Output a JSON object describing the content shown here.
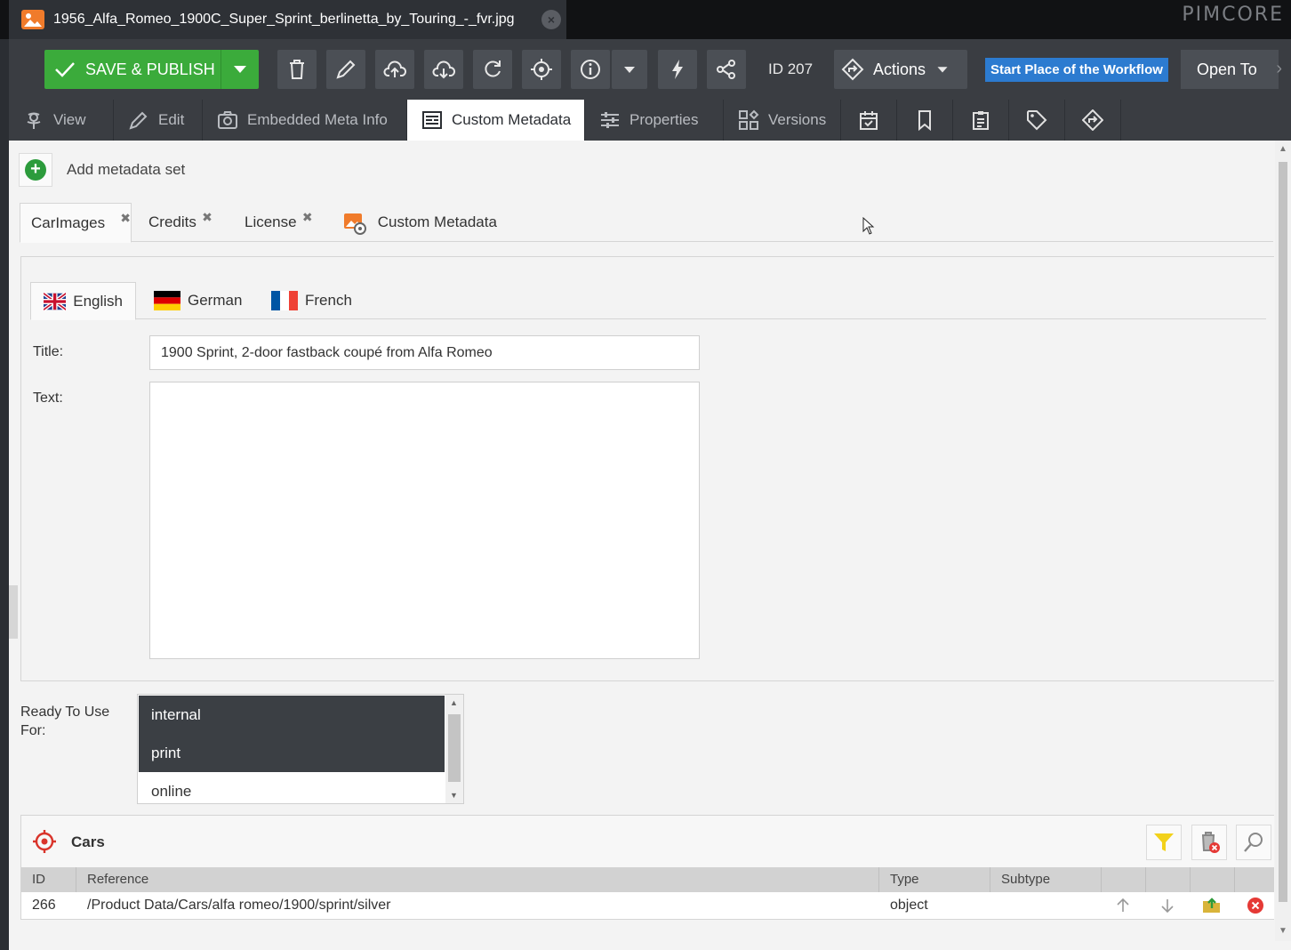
{
  "window": {
    "tab_title": "1956_Alfa_Romeo_1900C_Super_Sprint_berlinetta_by_Touring_-_fvr.jpg",
    "close_symbol": "×",
    "brand": "PIMCORE"
  },
  "toolbar": {
    "save_label": "SAVE & PUBLISH",
    "id_label": "ID 207",
    "actions_label": "Actions",
    "workflow_badge": "Start Place of the Workflow",
    "open_to_label": "Open To",
    "more_symbol": "›",
    "icons": [
      "checkmark-icon",
      "chevron-down-icon",
      "trash-icon",
      "pencil-icon",
      "upload-cloud-icon",
      "download-cloud-icon",
      "refresh-icon",
      "crosshair-icon",
      "info-icon",
      "chevron-down-icon",
      "lightning-icon",
      "share-icon",
      "workflow-icon"
    ]
  },
  "main_tabs": [
    {
      "label": "View",
      "icon": "flower-icon"
    },
    {
      "label": "Edit",
      "icon": "pencil-icon"
    },
    {
      "label": "Embedded Meta Info",
      "icon": "camera-icon"
    },
    {
      "label": "Custom Metadata",
      "icon": "metadata-icon",
      "active": true
    },
    {
      "label": "Properties",
      "icon": "sliders-icon"
    },
    {
      "label": "Versions",
      "icon": "versions-icon"
    },
    {
      "label": "",
      "icon": "calendar-icon"
    },
    {
      "label": "",
      "icon": "bookmark-icon"
    },
    {
      "label": "",
      "icon": "clipboard-icon"
    },
    {
      "label": "",
      "icon": "tag-icon"
    },
    {
      "label": "",
      "icon": "workflow-icon"
    }
  ],
  "metadata": {
    "add_set_label": "Add metadata set",
    "set_tabs": [
      {
        "label": "CarImages",
        "closable": true,
        "active": true
      },
      {
        "label": "Credits",
        "closable": true
      },
      {
        "label": "License",
        "closable": true
      },
      {
        "label": "Custom Metadata",
        "icon": "image-gear-icon"
      }
    ],
    "close_symbol": "✖",
    "languages": [
      {
        "label": "English",
        "flag": "uk-flag-icon",
        "active": true
      },
      {
        "label": "German",
        "flag": "germany-flag-icon"
      },
      {
        "label": "French",
        "flag": "france-flag-icon"
      }
    ],
    "title_label": "Title:",
    "title_value": "1900 Sprint, 2-door fastback coupé from Alfa Romeo",
    "text_label": "Text:",
    "text_value": "",
    "ready_label": "Ready To Use For:",
    "ready_options": [
      {
        "label": "internal",
        "selected": true
      },
      {
        "label": "print",
        "selected": true
      },
      {
        "label": "online",
        "selected": false
      }
    ]
  },
  "cars": {
    "title": "Cars",
    "columns": [
      "ID",
      "Reference",
      "Type",
      "Subtype"
    ],
    "rows": [
      {
        "id": "266",
        "reference": "/Product Data/Cars/alfa romeo/1900/sprint/silver",
        "type": "object",
        "subtype": ""
      }
    ]
  },
  "colors": {
    "accent_green": "#3bab3b",
    "workflow_blue": "#2c7bd0",
    "toolbar_bg": "#3a3d42",
    "selected_option_bg": "#3b3f44"
  }
}
